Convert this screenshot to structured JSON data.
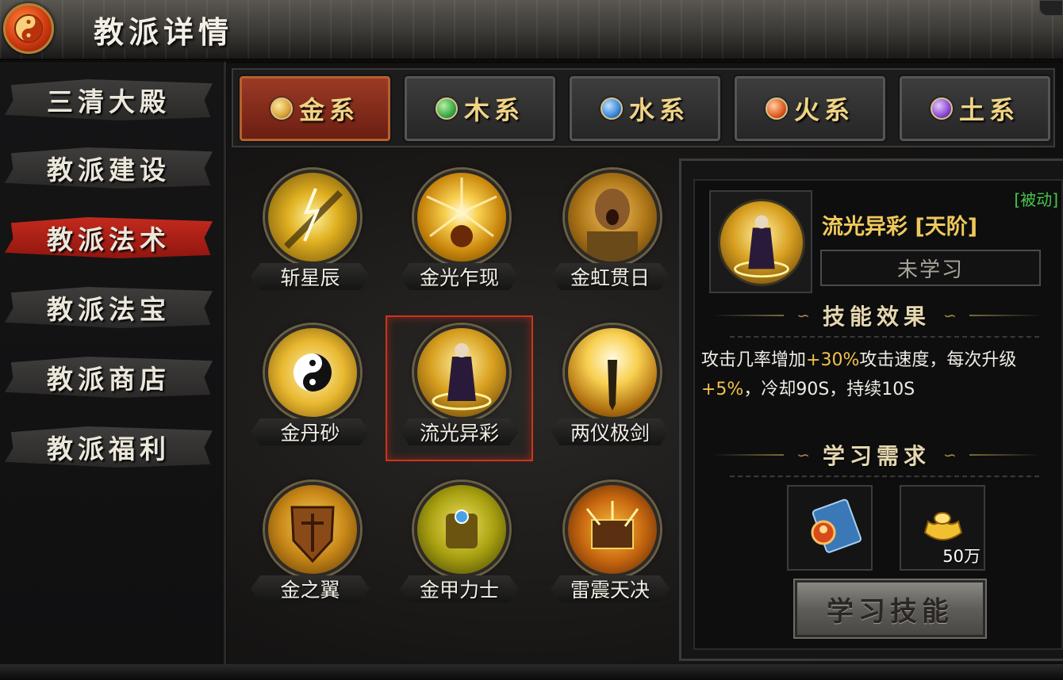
{
  "header": {
    "title": "教派详情"
  },
  "sidebar": {
    "items": [
      {
        "label": "三清大殿",
        "active": false
      },
      {
        "label": "教派建设",
        "active": false
      },
      {
        "label": "教派法术",
        "active": true
      },
      {
        "label": "教派法宝",
        "active": false
      },
      {
        "label": "教派商店",
        "active": false
      },
      {
        "label": "教派福利",
        "active": false
      }
    ]
  },
  "tabs": [
    {
      "label": "金系",
      "gem_color": "#d8a43a",
      "active": true
    },
    {
      "label": "木系",
      "gem_color": "#3aa84a",
      "active": false
    },
    {
      "label": "水系",
      "gem_color": "#3a86d8",
      "active": false
    },
    {
      "label": "火系",
      "gem_color": "#e05a22",
      "active": false
    },
    {
      "label": "土系",
      "gem_color": "#8a4ad0",
      "active": false
    }
  ],
  "skills": [
    {
      "name": "斩星辰",
      "icon": "sword-lightning-icon"
    },
    {
      "name": "金光乍现",
      "icon": "golden-burst-icon"
    },
    {
      "name": "金虹贯日",
      "icon": "roaring-warrior-icon"
    },
    {
      "name": "金丹砂",
      "icon": "yin-yang-icon"
    },
    {
      "name": "流光异彩",
      "icon": "robed-sage-icon",
      "selected": true
    },
    {
      "name": "两仪极剑",
      "icon": "glowing-blade-icon"
    },
    {
      "name": "金之翼",
      "icon": "shield-emblem-icon"
    },
    {
      "name": "金甲力士",
      "icon": "golden-golem-icon"
    },
    {
      "name": "雷震天决",
      "icon": "thunder-chest-icon"
    }
  ],
  "detail": {
    "tag": "[被动]",
    "name": "流光异彩 [天阶]",
    "status": "未学习",
    "effect_title": "技能效果",
    "effect_parts": [
      "攻击几率增加",
      "+30%",
      "攻击速度，每次升级",
      "+5%",
      "，冷却90S，持续10S"
    ],
    "req_title": "学习需求",
    "req_items": [
      {
        "icon": "skill-book-icon",
        "amount": ""
      },
      {
        "icon": "gold-ingot-icon",
        "amount": "50万"
      }
    ],
    "learn_button": "学习技能"
  },
  "colors": {
    "accent_red": "#c42a1e",
    "gold_text": "#f0c95a",
    "highlight": "#f0c24a",
    "passive_green": "#47c74a"
  }
}
